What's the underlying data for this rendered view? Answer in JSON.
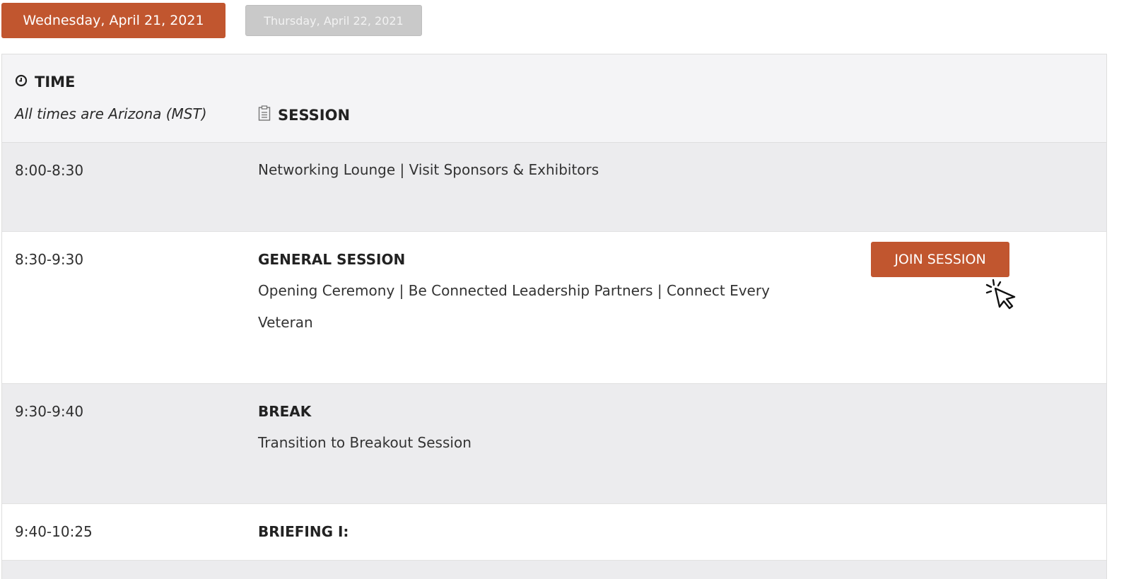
{
  "tabs": [
    {
      "label": "Wednesday, April 21, 2021",
      "active": true
    },
    {
      "label": "Thursday, April 22, 2021",
      "active": false
    }
  ],
  "header": {
    "time_label": "TIME",
    "timezone_note": "All times are Arizona (MST)",
    "session_label": "SESSION"
  },
  "icons": {
    "time": "clock-icon",
    "session": "clipboard-icon",
    "cursor": "pointer-click-icon"
  },
  "colors": {
    "accent": "#c1562f",
    "inactive_tab": "#c9c9c9",
    "row_grey": "#ececee",
    "header_bg": "#f4f4f6"
  },
  "rows": [
    {
      "time": "8:00-8:30",
      "title": "",
      "description": "Networking Lounge | Visit Sponsors & Exhibitors"
    },
    {
      "time": "8:30-9:30",
      "title": "GENERAL SESSION",
      "description": "Opening Ceremony | Be Connected Leadership Partners | Connect Every Veteran",
      "button": "JOIN SESSION"
    },
    {
      "time": "9:30-9:40",
      "title": "BREAK",
      "description": "Transition to Breakout Session"
    },
    {
      "time": "9:40-10:25",
      "title": "BRIEFING I:",
      "description": ""
    }
  ]
}
